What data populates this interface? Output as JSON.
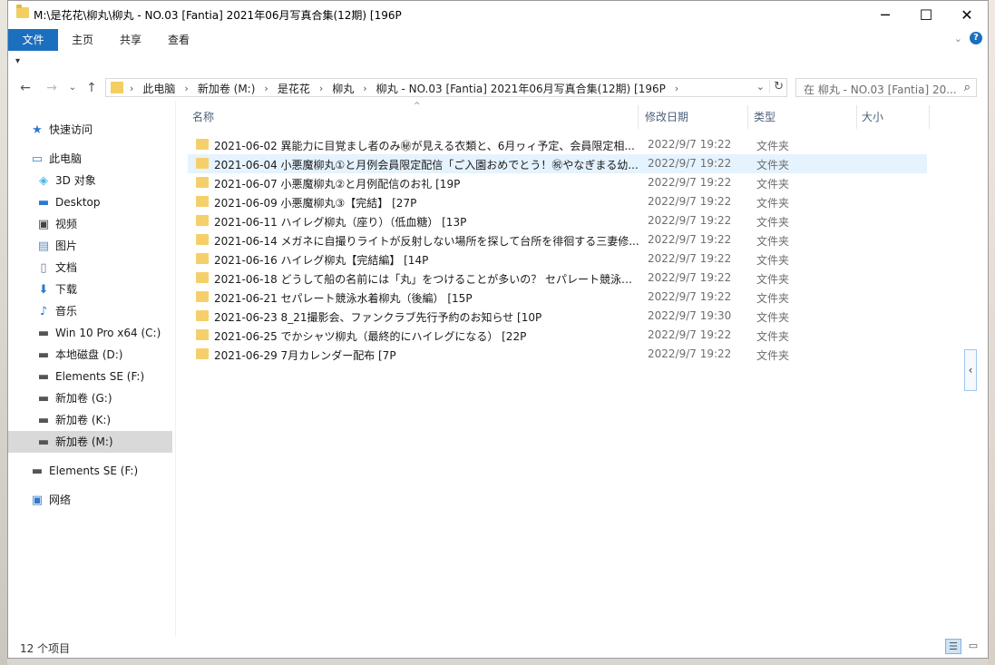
{
  "window": {
    "title": "M:\\是花花\\柳丸\\柳丸 - NO.03 [Fantia] 2021年06月写真合集(12期) [196P",
    "minimize": "─",
    "maximize": "☐",
    "close": "✕"
  },
  "ribbon": {
    "tabs": [
      "文件",
      "主页",
      "共享",
      "查看"
    ],
    "expand_icon": "⌄",
    "help_icon": "?"
  },
  "qat_icon": "▾",
  "nav": {
    "back": "←",
    "forward": "→",
    "recent": "⌄",
    "up": "↑"
  },
  "address": {
    "crumbs": [
      "此电脑",
      "新加卷 (M:)",
      "是花花",
      "柳丸",
      "柳丸 - NO.03 [Fantia] 2021年06月写真合集(12期) [196P"
    ],
    "separator": "›",
    "dropdown": "⌄",
    "refresh": "↻"
  },
  "search": {
    "placeholder": "在 柳丸 - NO.03 [Fantia] 20...",
    "icon": "⌕"
  },
  "sidebar": {
    "quick_access": "快速访问",
    "this_pc": "此电脑",
    "items": [
      {
        "label": "3D 对象",
        "icon": "cube-icon"
      },
      {
        "label": "Desktop",
        "icon": "desktop-icon"
      },
      {
        "label": "视频",
        "icon": "video-icon"
      },
      {
        "label": "图片",
        "icon": "picture-icon"
      },
      {
        "label": "文档",
        "icon": "document-icon"
      },
      {
        "label": "下载",
        "icon": "download-icon"
      },
      {
        "label": "音乐",
        "icon": "music-icon"
      },
      {
        "label": "Win 10 Pro x64 (C:)",
        "icon": "drive-icon"
      },
      {
        "label": "本地磁盘 (D:)",
        "icon": "drive-icon"
      },
      {
        "label": "Elements SE (F:)",
        "icon": "drive-icon"
      },
      {
        "label": "新加卷 (G:)",
        "icon": "drive-icon"
      },
      {
        "label": "新加卷 (K:)",
        "icon": "drive-icon"
      },
      {
        "label": "新加卷 (M:)",
        "icon": "drive-icon"
      }
    ],
    "elements_se": "Elements SE (F:)",
    "network": "网络"
  },
  "columns": {
    "name": "名称",
    "date": "修改日期",
    "type": "类型",
    "size": "大小",
    "sort_indicator": "^"
  },
  "files": [
    {
      "name": "2021-06-02 異能力に目覚まし者のみ㊙が見える衣類と、6月ヮィ予定、会員限定相...",
      "date": "2022/9/7 19:22",
      "type": "文件夹"
    },
    {
      "name": "2021-06-04 小悪魔柳丸①と月例会員限定配信「ご入園おめでとう！㊗やなぎまる幼...",
      "date": "2022/9/7 19:22",
      "type": "文件夹"
    },
    {
      "name": "2021-06-07 小悪魔柳丸②と月例配信のお礼 [19P",
      "date": "2022/9/7 19:22",
      "type": "文件夹"
    },
    {
      "name": "2021-06-09 小悪魔柳丸③【完結】 [27P",
      "date": "2022/9/7 19:22",
      "type": "文件夹"
    },
    {
      "name": "2021-06-11 ハイレグ柳丸（座り）（低血糖） [13P",
      "date": "2022/9/7 19:22",
      "type": "文件夹"
    },
    {
      "name": "2021-06-14 メガネに自撮りライトが反射しない場所を探して台所を徘徊する三妻修...",
      "date": "2022/9/7 19:22",
      "type": "文件夹"
    },
    {
      "name": "2021-06-16 ハイレグ柳丸【完結編】 [14P",
      "date": "2022/9/7 19:22",
      "type": "文件夹"
    },
    {
      "name": "2021-06-18 どうして船の名前には「丸」をつけることが多いの？ セパレート競泳水...",
      "date": "2022/9/7 19:22",
      "type": "文件夹"
    },
    {
      "name": "2021-06-21 セパレート競泳水着柳丸（後編） [15P",
      "date": "2022/9/7 19:22",
      "type": "文件夹"
    },
    {
      "name": "2021-06-23 8_21撮影会、ファンクラブ先行予約のお知らせ [10P",
      "date": "2022/9/7 19:30",
      "type": "文件夹"
    },
    {
      "name": "2021-06-25 でかシャツ柳丸（最終的にハイレグになる） [22P",
      "date": "2022/9/7 19:22",
      "type": "文件夹"
    },
    {
      "name": "2021-06-29 7月カレンダー配布 [7P",
      "date": "2022/9/7 19:22",
      "type": "文件夹"
    }
  ],
  "status": {
    "count": "12 个项目"
  },
  "preview_toggle": "‹"
}
